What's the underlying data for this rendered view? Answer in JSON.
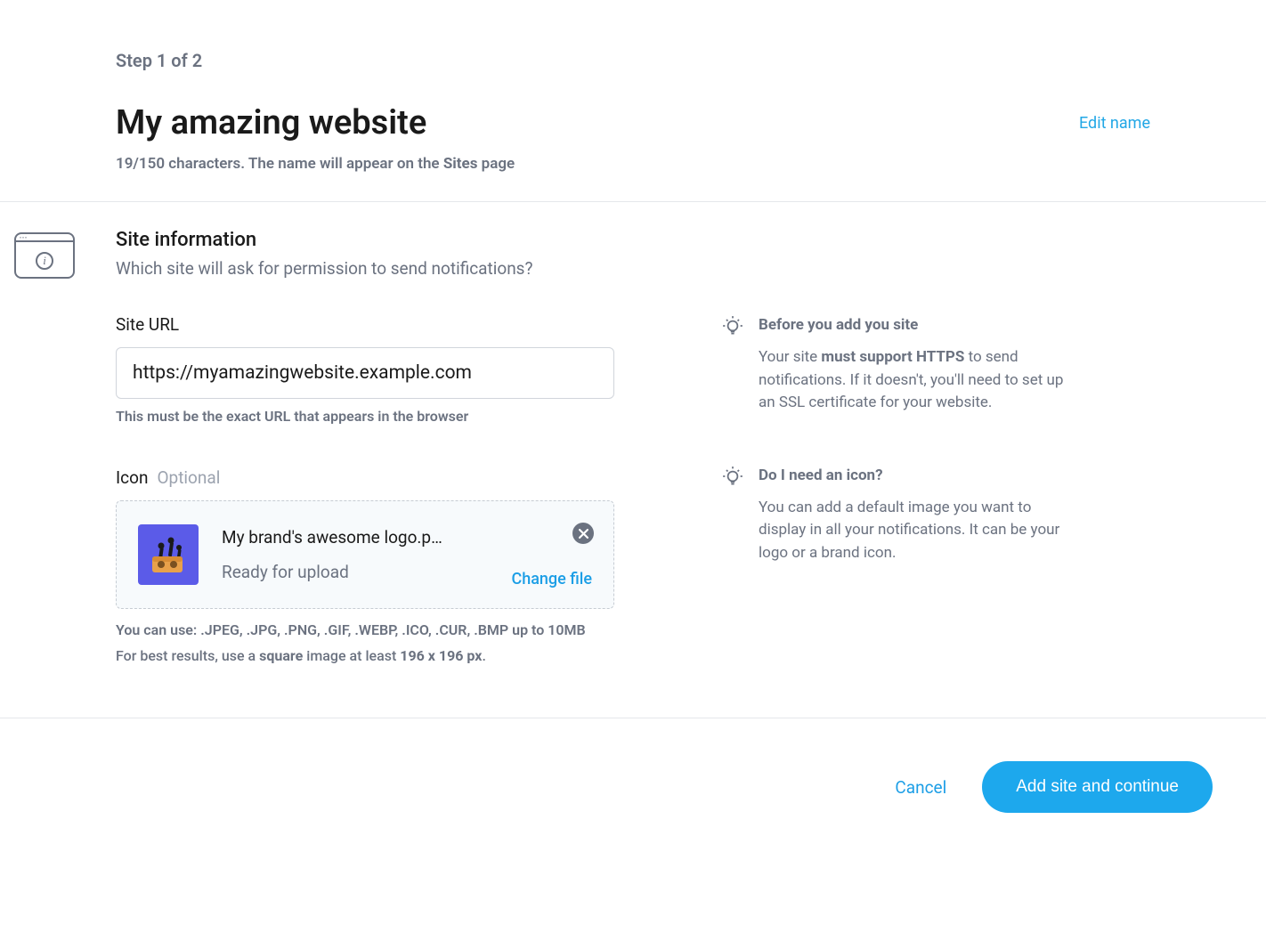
{
  "step_label": "Step 1 of 2",
  "title": "My amazing website",
  "edit_name_label": "Edit name",
  "char_info_prefix": "19/150 characters. The name will appear on the ",
  "char_info_bold": "Sites",
  "char_info_suffix": " page",
  "section": {
    "title": "Site information",
    "subtitle": "Which site will ask for permission to send notifications?"
  },
  "url_field": {
    "label": "Site URL",
    "value": "https://myamazingwebsite.example.com",
    "help": "This must be the exact URL that appears in the browser"
  },
  "icon_field": {
    "label": "Icon",
    "optional": "Optional",
    "file_name": "My brand's awesome logo.p…",
    "status": "Ready for upload",
    "change_label": "Change file",
    "help_line1": "You can use: .JPEG, .JPG, .PNG, .GIF, .WEBP, .ICO, .CUR, .BMP up to 10MB",
    "help_line2_pre": "For best results, use a ",
    "help_line2_b1": "square",
    "help_line2_mid": " image at least ",
    "help_line2_b2": "196 x 196 px",
    "help_line2_end": "."
  },
  "tips": {
    "before": {
      "title": "Before you add you site",
      "text_pre": "Your site ",
      "text_b": "must support HTTPS",
      "text_post": " to send notifications. If it doesn't, you'll need to set up an SSL certificate for your website."
    },
    "icon": {
      "title": "Do I need an icon?",
      "text": "You can add a default image you want to display in all your notifications. It can be your logo or a brand icon."
    }
  },
  "footer": {
    "cancel": "Cancel",
    "primary": "Add site and continue"
  }
}
